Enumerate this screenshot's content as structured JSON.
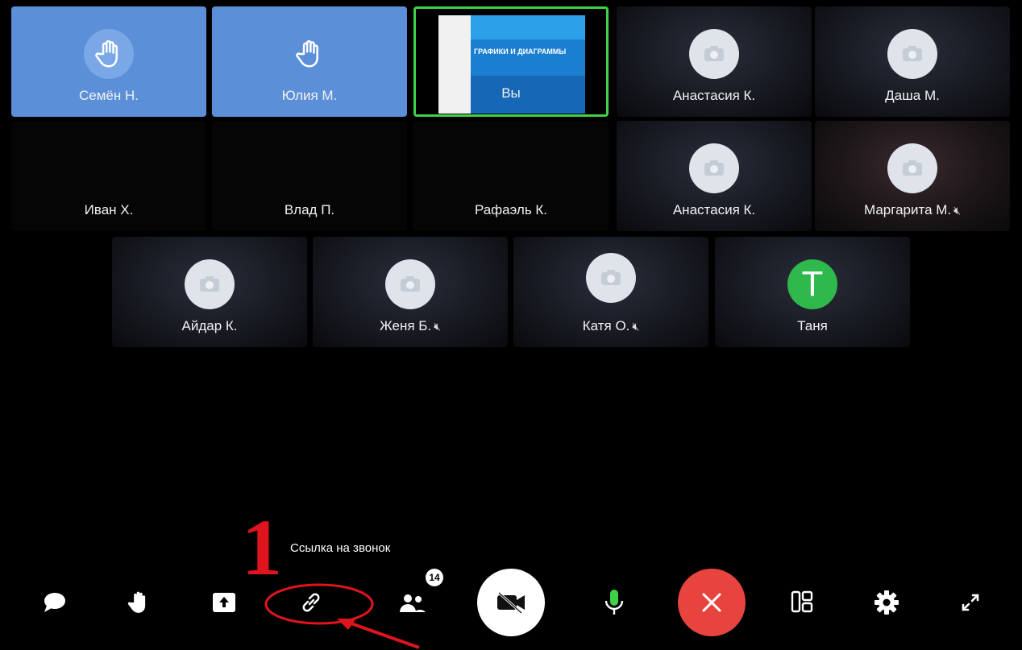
{
  "participants": [
    {
      "name": "Семён Н."
    },
    {
      "name": "Юлия М."
    },
    {
      "name": "Вы",
      "slide_title": "ГРАФИКИ И ДИАГРАММЫ"
    },
    {
      "name": "Анастасия К."
    },
    {
      "name": "Даша М."
    },
    {
      "name": "Иван Х."
    },
    {
      "name": "Влад П."
    },
    {
      "name": "Рафаэль К."
    },
    {
      "name": "Анастасия К."
    },
    {
      "name": "Маргарита М."
    },
    {
      "name": "Айдар К."
    },
    {
      "name": "Женя Б."
    },
    {
      "name": "Катя О."
    },
    {
      "name": "Таня",
      "initial": "Т"
    }
  ],
  "toolbar": {
    "tooltip": "Ссылка на звонок",
    "participants_count": "14",
    "buttons": [
      "chat-icon",
      "raise-hand-icon",
      "share-screen-icon",
      "link-icon",
      "participants-icon",
      "camera-off-icon",
      "microphone-icon",
      "end-call-icon",
      "layout-icon",
      "settings-icon",
      "fullscreen-icon"
    ]
  },
  "annotation": {
    "number": "1"
  },
  "colors": {
    "raised_hand_tile": "#5b8fd8",
    "self_border": "#3fd246",
    "end_call": "#e8443f",
    "annotation": "#e0141c",
    "avatar_green": "#2fb84b"
  }
}
